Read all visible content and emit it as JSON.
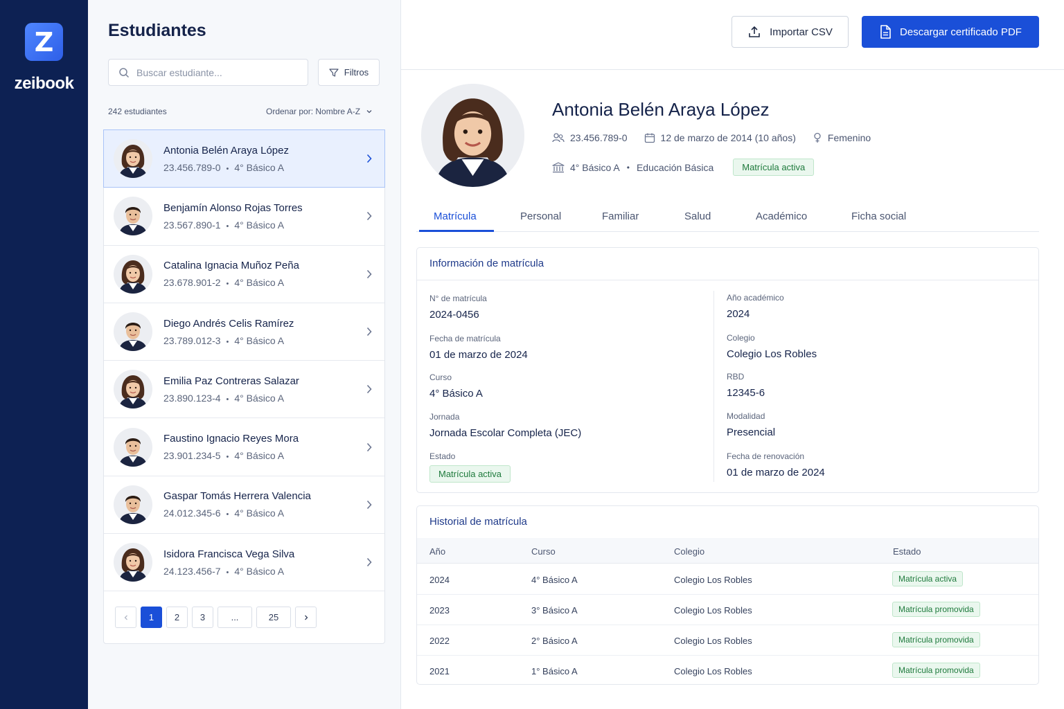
{
  "app": {
    "brand": "zeibook",
    "logo_letter": "Z"
  },
  "list": {
    "title": "Estudiantes",
    "search_placeholder": "Buscar estudiante...",
    "filters_label": "Filtros",
    "count_label": "242 estudiantes",
    "sort_label": "Ordenar por: Nombre A-Z",
    "students": [
      {
        "name": "Antonia Belén Araya López",
        "rut": "23.456.789-0",
        "course": "4° Básico A",
        "gender": "f",
        "selected": true
      },
      {
        "name": "Benjamín Alonso Rojas Torres",
        "rut": "23.567.890-1",
        "course": "4° Básico A",
        "gender": "m"
      },
      {
        "name": "Catalina Ignacia Muñoz Peña",
        "rut": "23.678.901-2",
        "course": "4° Básico A",
        "gender": "f"
      },
      {
        "name": "Diego Andrés Celis Ramírez",
        "rut": "23.789.012-3",
        "course": "4° Básico A",
        "gender": "m"
      },
      {
        "name": "Emilia Paz Contreras Salazar",
        "rut": "23.890.123-4",
        "course": "4° Básico A",
        "gender": "f"
      },
      {
        "name": "Faustino Ignacio Reyes Mora",
        "rut": "23.901.234-5",
        "course": "4° Básico A",
        "gender": "m"
      },
      {
        "name": "Gaspar Tomás Herrera Valencia",
        "rut": "24.012.345-6",
        "course": "4° Básico A",
        "gender": "m"
      },
      {
        "name": "Isidora Francisca Vega Silva",
        "rut": "24.123.456-7",
        "course": "4° Básico A",
        "gender": "f"
      }
    ],
    "pagination": {
      "pages": [
        "1",
        "2",
        "3",
        "...",
        "25"
      ],
      "current": "1"
    }
  },
  "toolbar": {
    "import_label": "Importar CSV",
    "pdf_label": "Descargar certificado PDF"
  },
  "profile": {
    "name": "Antonia Belén Araya López",
    "rut": "23.456.789-0",
    "birth": "12 de marzo de 2014 (10 años)",
    "gender": "Femenino",
    "course": "4° Básico A",
    "level": "Educación Básica",
    "status": "Matrícula activa"
  },
  "tabs": [
    "Matrícula",
    "Personal",
    "Familiar",
    "Salud",
    "Académico",
    "Ficha social"
  ],
  "enrollment": {
    "title": "Información de matrícula",
    "left": [
      {
        "label": "N° de matrícula",
        "value": "2024-0456"
      },
      {
        "label": "Fecha de matrícula",
        "value": "01 de marzo de 2024"
      },
      {
        "label": "Curso",
        "value": "4° Básico A"
      },
      {
        "label": "Jornada",
        "value": "Jornada Escolar Completa (JEC)"
      },
      {
        "label": "Estado",
        "value": "Matrícula activa"
      }
    ],
    "right": [
      {
        "label": "Año académico",
        "value": "2024"
      },
      {
        "label": "Colegio",
        "value": "Colegio Los Robles"
      },
      {
        "label": "RBD",
        "value": "12345-6"
      },
      {
        "label": "Modalidad",
        "value": "Presencial"
      },
      {
        "label": "Fecha de renovación",
        "value": "01 de marzo de 2024"
      }
    ]
  },
  "history": {
    "title": "Historial de matrícula",
    "columns": [
      "Año",
      "Curso",
      "Colegio",
      "Estado"
    ],
    "rows": [
      [
        "2024",
        "4° Básico A",
        "Colegio Los Robles",
        "Matrícula activa"
      ],
      [
        "2023",
        "3° Básico A",
        "Colegio Los Robles",
        "Matrícula promovida"
      ],
      [
        "2022",
        "2° Básico A",
        "Colegio Los Robles",
        "Matrícula promovida"
      ],
      [
        "2021",
        "1° Básico A",
        "Colegio Los Robles",
        "Matrícula promovida"
      ]
    ]
  },
  "colors": {
    "sidebar": "#0d2153",
    "accent": "#1a4fd8",
    "success": "#1e7a3c"
  }
}
